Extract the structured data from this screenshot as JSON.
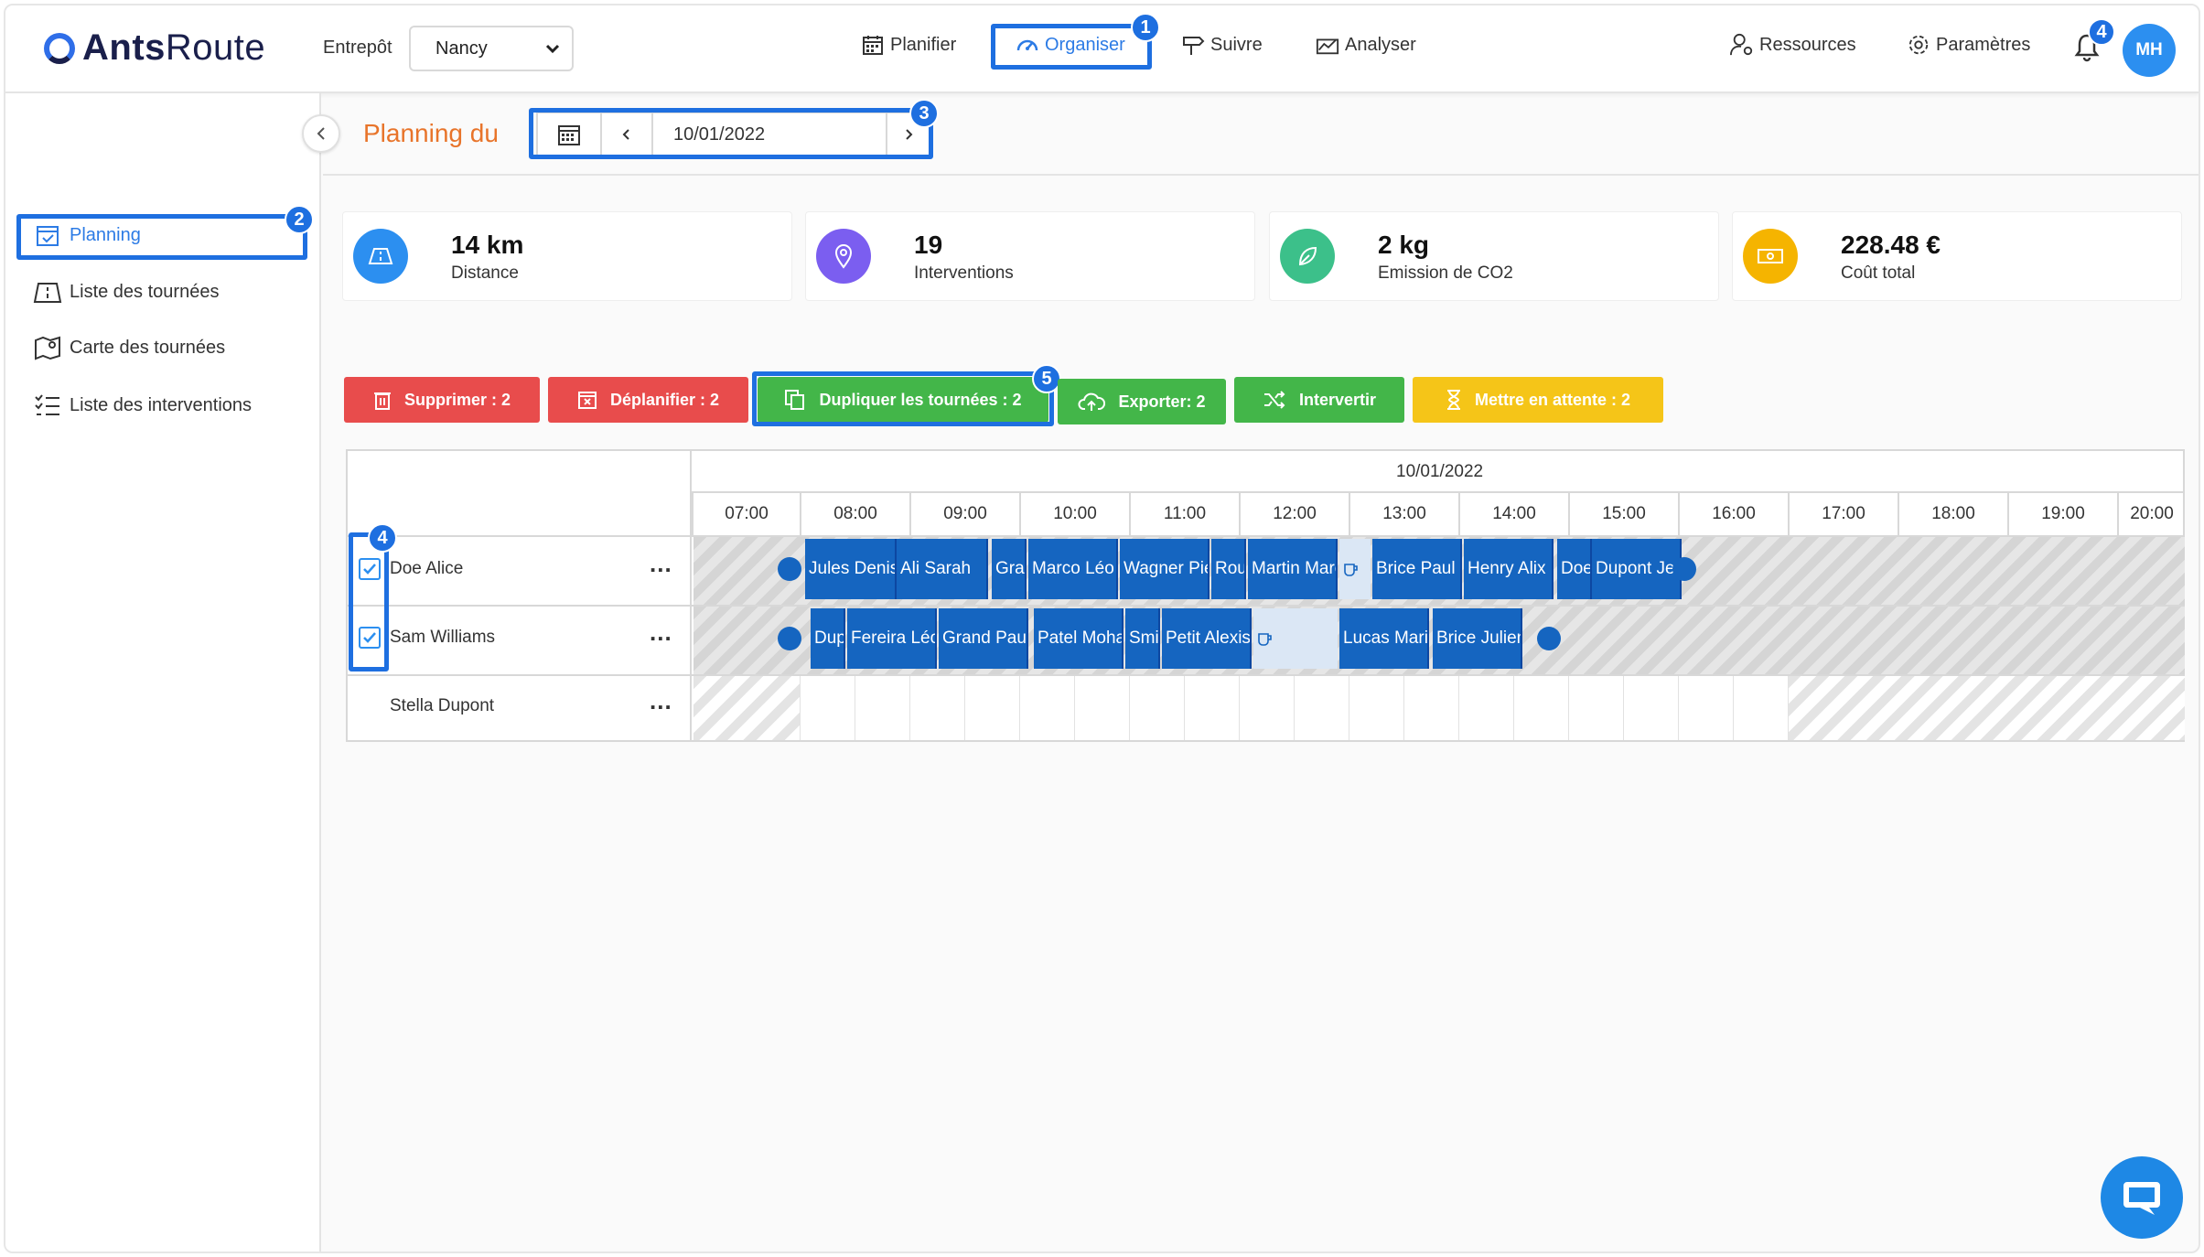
{
  "app": {
    "logo_strong": "Ants",
    "logo_light": "Route"
  },
  "header": {
    "depot_label": "Entrepôt",
    "depot_value": "Nancy",
    "nav": [
      {
        "label": "Planifier",
        "icon": "calendar-icon"
      },
      {
        "label": "Organiser",
        "icon": "gauge-icon"
      },
      {
        "label": "Suivre",
        "icon": "signpost-icon"
      },
      {
        "label": "Analyser",
        "icon": "chart-icon"
      }
    ],
    "resources_label": "Ressources",
    "settings_label": "Paramètres",
    "notification_count": "4",
    "avatar_initials": "MH"
  },
  "annotations": {
    "nav_organiser": "1",
    "sidebar_planning": "2",
    "date_picker": "3",
    "row_checkboxes": "4",
    "duplicate_button": "5"
  },
  "sidebar": {
    "items": [
      {
        "label": "Planning",
        "icon": "calendar-check-icon"
      },
      {
        "label": "Liste des tournées",
        "icon": "map-fold-icon"
      },
      {
        "label": "Carte des tournées",
        "icon": "map-pin-icon"
      },
      {
        "label": "Liste des interventions",
        "icon": "list-check-icon"
      }
    ]
  },
  "planning": {
    "title": "Planning du",
    "date": "10/01/2022"
  },
  "kpis": [
    {
      "value": "14 km",
      "label": "Distance",
      "color": "#2c8ff0",
      "icon": "road-icon"
    },
    {
      "value": "19",
      "label": "Interventions",
      "color": "#7b5ef0",
      "icon": "location-pin-icon"
    },
    {
      "value": "2 kg",
      "label": "Emission de CO2",
      "color": "#3cc08a",
      "icon": "leaf-icon"
    },
    {
      "value": "228.48 €",
      "label": "Coût total",
      "color": "#f5b400",
      "icon": "banknote-icon"
    }
  ],
  "actions": [
    {
      "label": "Supprimer : 2",
      "color": "#e84c4c",
      "icon": "trash-icon"
    },
    {
      "label": "Déplanifier : 2",
      "color": "#e84c4c",
      "icon": "calendar-x-icon"
    },
    {
      "label": "Dupliquer les tournées : 2",
      "color": "#43b649",
      "icon": "copy-icon"
    },
    {
      "label": "Exporter: 2",
      "color": "#43b649",
      "icon": "cloud-upload-icon"
    },
    {
      "label": "Intervertir",
      "color": "#43b649",
      "icon": "shuffle-icon"
    },
    {
      "label": "Mettre en attente : 2",
      "color": "#f5c518",
      "icon": "hourglass-icon"
    }
  ],
  "gantt": {
    "date": "10/01/2022",
    "hours": [
      "07:00",
      "08:00",
      "09:00",
      "10:00",
      "11:00",
      "12:00",
      "13:00",
      "14:00",
      "15:00",
      "16:00",
      "17:00",
      "18:00",
      "19:00",
      "20:00"
    ],
    "rows": [
      {
        "name": "Doe Alice",
        "checked": true,
        "tasks": [
          "Jules Denis",
          "Ali Sarah",
          "Grand",
          "Marco Léo",
          "Wagner Pierre",
          "Roux",
          "Martin Marc",
          "Brice Paul",
          "Henry Alix",
          "Doe",
          "Dupont Jean"
        ]
      },
      {
        "name": "Sam Williams",
        "checked": true,
        "tasks": [
          "Dupuis",
          "Fereira Léo",
          "Grand Paul",
          "Patel Mohan",
          "Smith",
          "Petit Alexis",
          "Lucas Marie",
          "Brice Julien"
        ]
      },
      {
        "name": "Stella Dupont",
        "checked": false,
        "tasks": []
      }
    ],
    "more_label": "..."
  }
}
